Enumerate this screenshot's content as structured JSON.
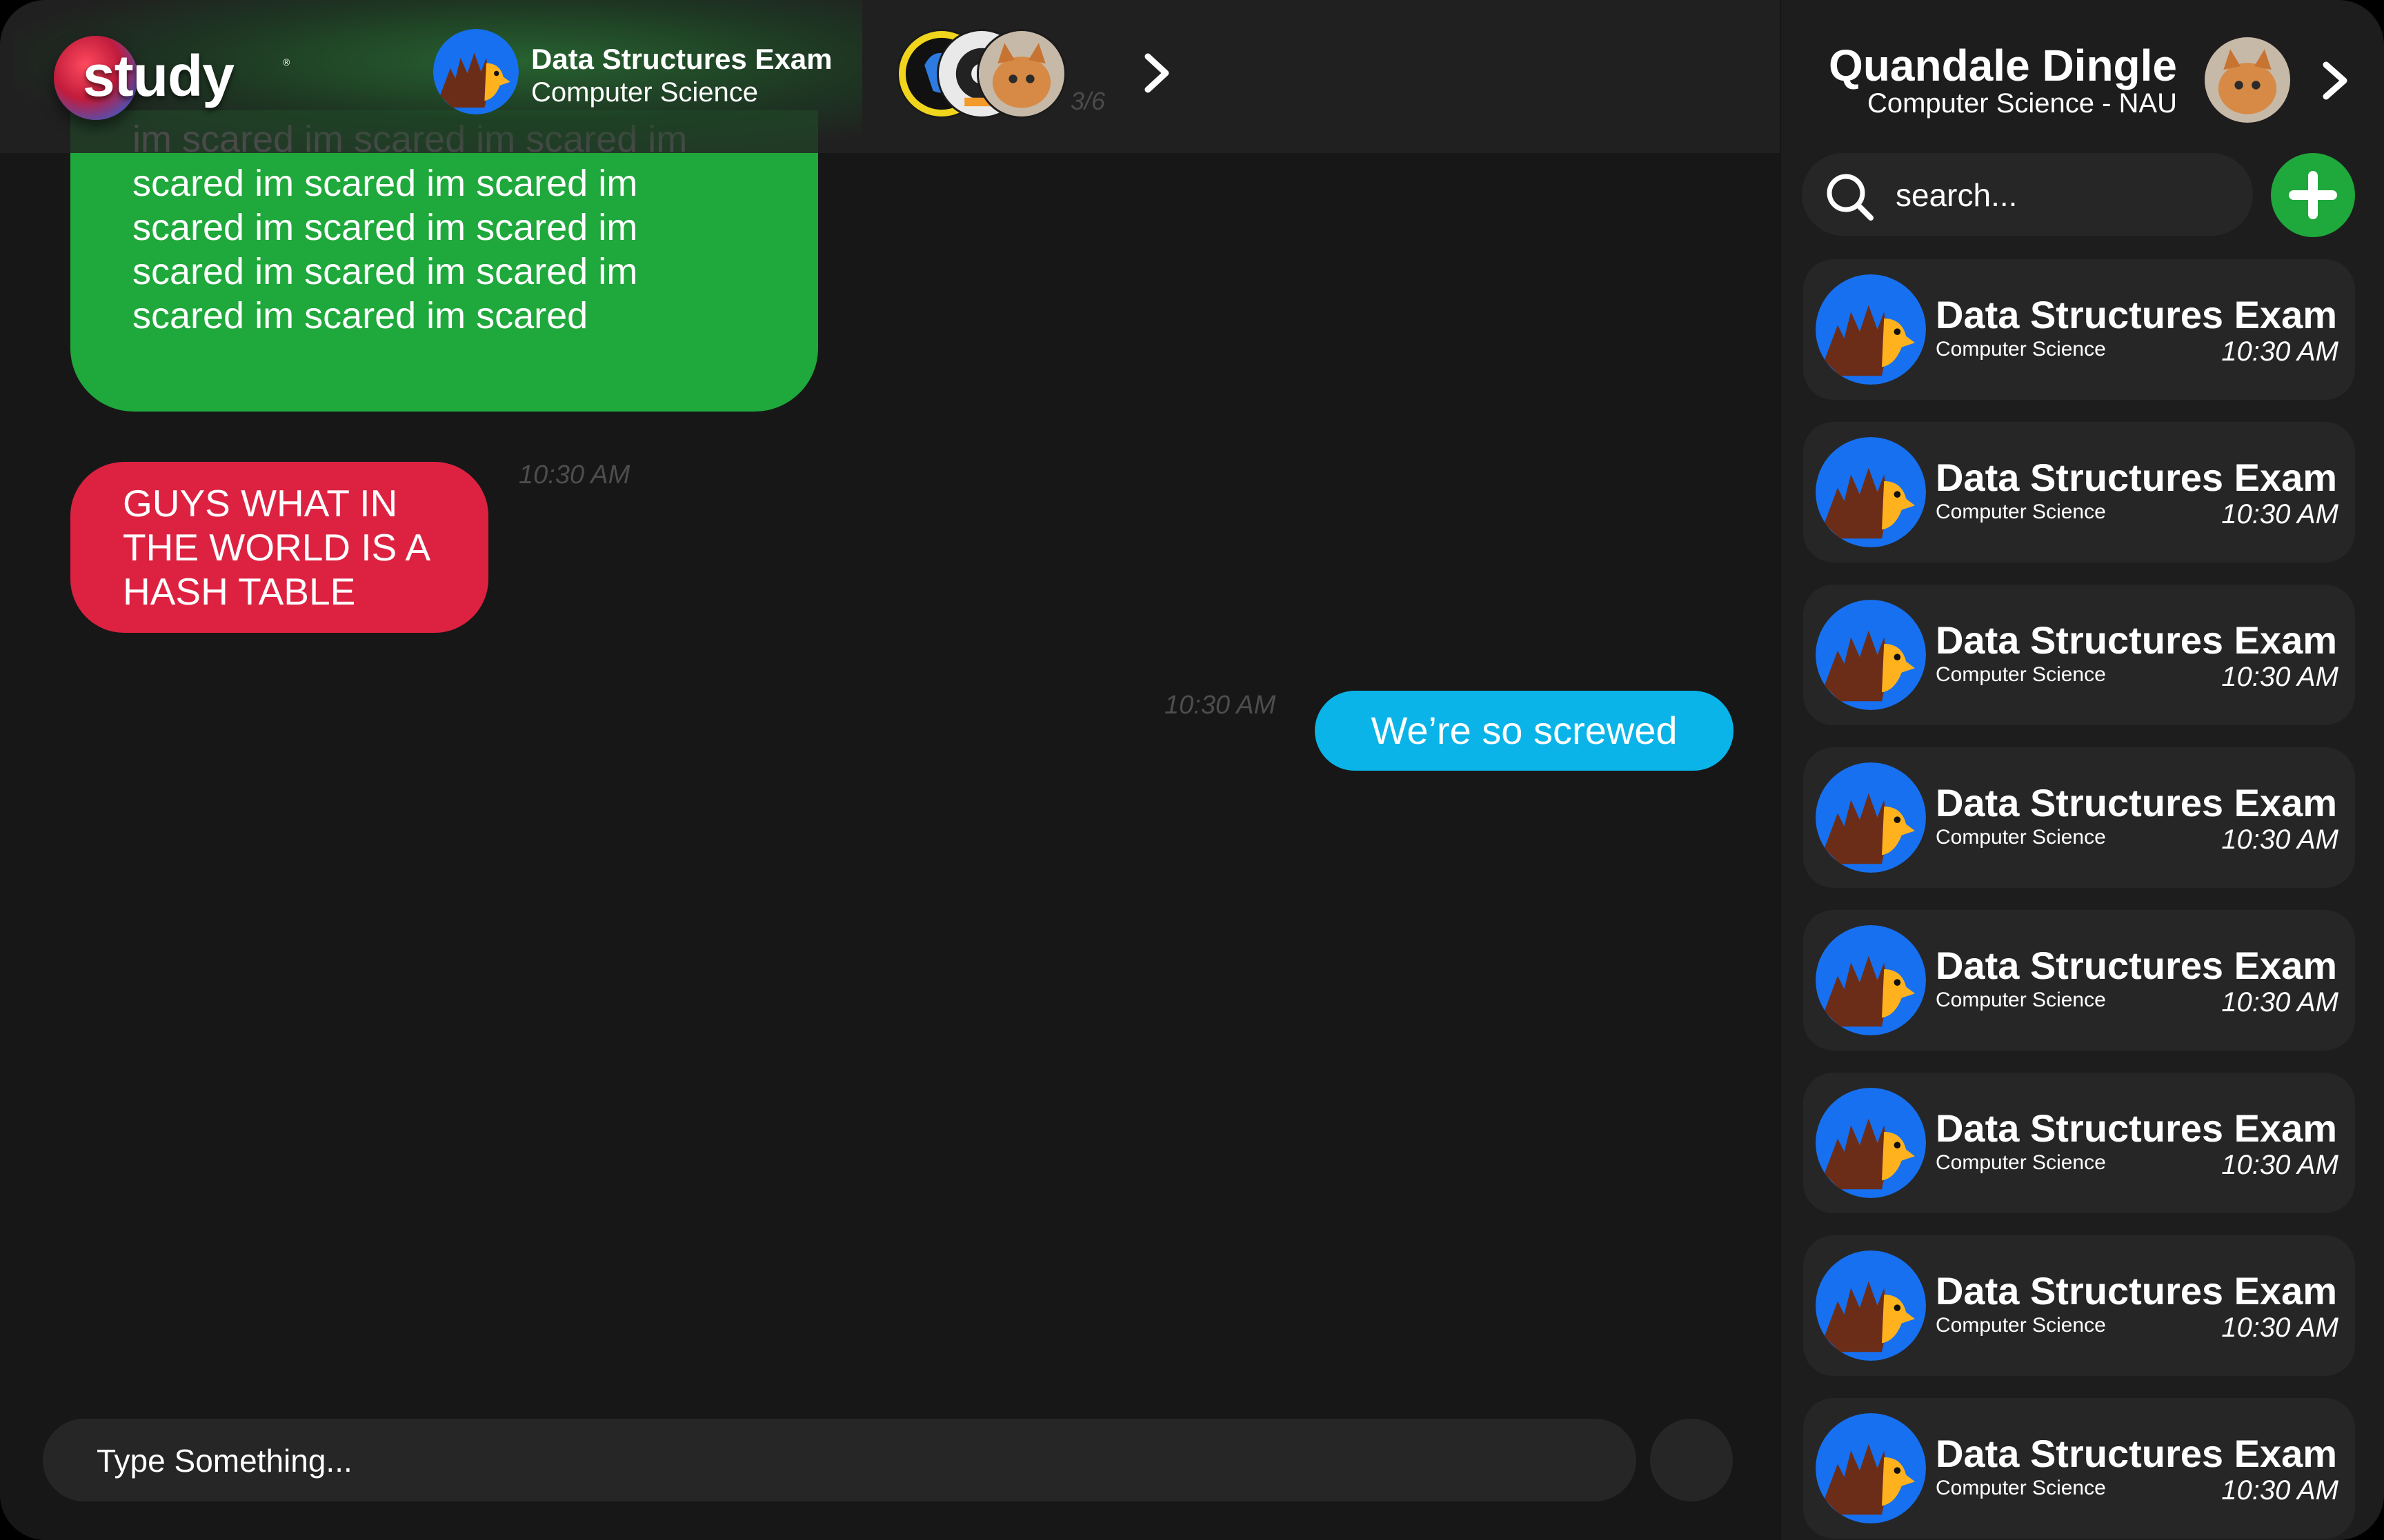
{
  "brand": {
    "logo_text": "study",
    "logo_mark": "®"
  },
  "header": {
    "group_title": "Data Structures Exam",
    "group_subtitle": "Computer Science",
    "members_count": "3/6"
  },
  "messages": [
    {
      "kind": "received",
      "color": "#1fa83b",
      "text": "im scared im scared im scared im scared im scared im scared im scared im scared im scared im scared im scared im scared im scared im scared im scared",
      "time": ""
    },
    {
      "kind": "received",
      "color": "#dd2241",
      "text": "GUYS WHAT IN THE WORLD IS A HASH TABLE",
      "time": "10:30 AM"
    },
    {
      "kind": "sent",
      "color": "#0ab4e8",
      "text": "We’re so screwed",
      "time": "10:30 AM"
    }
  ],
  "composer": {
    "placeholder": "Type Something..."
  },
  "user": {
    "name": "Quandale Dingle",
    "subtitle": "Computer Science - NAU"
  },
  "search": {
    "placeholder": "search..."
  },
  "chats": [
    {
      "title": "Data Structures Exam",
      "subtitle": "Computer Science",
      "time": "10:30 AM"
    },
    {
      "title": "Data Structures Exam",
      "subtitle": "Computer Science",
      "time": "10:30 AM"
    },
    {
      "title": "Data Structures Exam",
      "subtitle": "Computer Science",
      "time": "10:30 AM"
    },
    {
      "title": "Data Structures Exam",
      "subtitle": "Computer Science",
      "time": "10:30 AM"
    },
    {
      "title": "Data Structures Exam",
      "subtitle": "Computer Science",
      "time": "10:30 AM"
    },
    {
      "title": "Data Structures Exam",
      "subtitle": "Computer Science",
      "time": "10:30 AM"
    },
    {
      "title": "Data Structures Exam",
      "subtitle": "Computer Science",
      "time": "10:30 AM"
    },
    {
      "title": "Data Structures Exam",
      "subtitle": "Computer Science",
      "time": "10:30 AM"
    }
  ],
  "colors": {
    "background": "#161616",
    "panel": "#1d1d1d",
    "field": "#262626",
    "accent_green": "#1fa83b",
    "accent_red": "#dd2241",
    "accent_blue": "#0ab4e8"
  },
  "icons": {
    "group": "hedgehog-icon",
    "next": "chevron-right-icon",
    "search": "search-icon",
    "add": "plus-icon"
  }
}
